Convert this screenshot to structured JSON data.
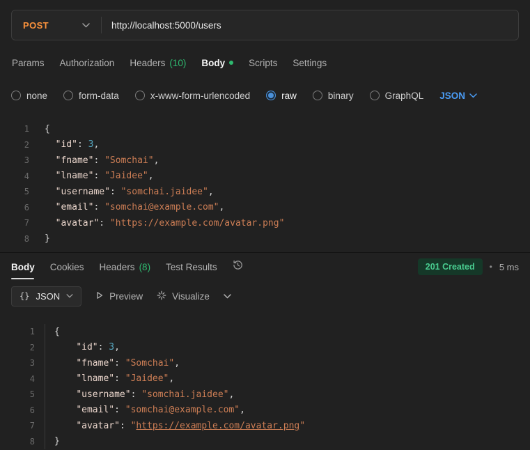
{
  "request": {
    "method": "POST",
    "url": "http://localhost:5000/users",
    "tabs": [
      {
        "label": "Params"
      },
      {
        "label": "Authorization"
      },
      {
        "label": "Headers",
        "count": "(10)"
      },
      {
        "label": "Body"
      },
      {
        "label": "Scripts"
      },
      {
        "label": "Settings"
      }
    ],
    "body_types": [
      "none",
      "form-data",
      "x-www-form-urlencoded",
      "raw",
      "binary",
      "GraphQL"
    ],
    "language": "JSON"
  },
  "request_code": [
    [
      {
        "t": "{",
        "c": "p"
      }
    ],
    [
      {
        "t": "  ",
        "c": "p"
      },
      {
        "t": "\"id\"",
        "c": "k"
      },
      {
        "t": ": ",
        "c": "p"
      },
      {
        "t": "3",
        "c": "n"
      },
      {
        "t": ",",
        "c": "p"
      }
    ],
    [
      {
        "t": "  ",
        "c": "p"
      },
      {
        "t": "\"fname\"",
        "c": "k"
      },
      {
        "t": ": ",
        "c": "p"
      },
      {
        "t": "\"Somchai\"",
        "c": "s"
      },
      {
        "t": ",",
        "c": "p"
      }
    ],
    [
      {
        "t": "  ",
        "c": "p"
      },
      {
        "t": "\"lname\"",
        "c": "k"
      },
      {
        "t": ": ",
        "c": "p"
      },
      {
        "t": "\"Jaidee\"",
        "c": "s"
      },
      {
        "t": ",",
        "c": "p"
      }
    ],
    [
      {
        "t": "  ",
        "c": "p"
      },
      {
        "t": "\"username\"",
        "c": "k"
      },
      {
        "t": ": ",
        "c": "p"
      },
      {
        "t": "\"somchai.jaidee\"",
        "c": "s"
      },
      {
        "t": ",",
        "c": "p"
      }
    ],
    [
      {
        "t": "  ",
        "c": "p"
      },
      {
        "t": "\"email\"",
        "c": "k"
      },
      {
        "t": ": ",
        "c": "p"
      },
      {
        "t": "\"somchai@example.com\"",
        "c": "s"
      },
      {
        "t": ",",
        "c": "p"
      }
    ],
    [
      {
        "t": "  ",
        "c": "p"
      },
      {
        "t": "\"avatar\"",
        "c": "k"
      },
      {
        "t": ": ",
        "c": "p"
      },
      {
        "t": "\"https://example.com/avatar.png\"",
        "c": "s"
      }
    ],
    [
      {
        "t": "}",
        "c": "p"
      }
    ]
  ],
  "response": {
    "tabs": [
      {
        "label": "Body"
      },
      {
        "label": "Cookies"
      },
      {
        "label": "Headers",
        "count": "(8)"
      },
      {
        "label": "Test Results"
      }
    ],
    "status": "201 Created",
    "separator": "•",
    "time": "5 ms",
    "braces_icon": "{}",
    "format_label": "JSON",
    "preview_label": "Preview",
    "visualize_label": "Visualize"
  },
  "response_code": [
    [
      {
        "t": "{",
        "c": "p"
      }
    ],
    [
      {
        "t": "    ",
        "c": "p"
      },
      {
        "t": "\"id\"",
        "c": "k"
      },
      {
        "t": ": ",
        "c": "p"
      },
      {
        "t": "3",
        "c": "n"
      },
      {
        "t": ",",
        "c": "p"
      }
    ],
    [
      {
        "t": "    ",
        "c": "p"
      },
      {
        "t": "\"fname\"",
        "c": "k"
      },
      {
        "t": ": ",
        "c": "p"
      },
      {
        "t": "\"Somchai\"",
        "c": "s"
      },
      {
        "t": ",",
        "c": "p"
      }
    ],
    [
      {
        "t": "    ",
        "c": "p"
      },
      {
        "t": "\"lname\"",
        "c": "k"
      },
      {
        "t": ": ",
        "c": "p"
      },
      {
        "t": "\"Jaidee\"",
        "c": "s"
      },
      {
        "t": ",",
        "c": "p"
      }
    ],
    [
      {
        "t": "    ",
        "c": "p"
      },
      {
        "t": "\"username\"",
        "c": "k"
      },
      {
        "t": ": ",
        "c": "p"
      },
      {
        "t": "\"somchai.jaidee\"",
        "c": "s"
      },
      {
        "t": ",",
        "c": "p"
      }
    ],
    [
      {
        "t": "    ",
        "c": "p"
      },
      {
        "t": "\"email\"",
        "c": "k"
      },
      {
        "t": ": ",
        "c": "p"
      },
      {
        "t": "\"somchai@example.com\"",
        "c": "s"
      },
      {
        "t": ",",
        "c": "p"
      }
    ],
    [
      {
        "t": "    ",
        "c": "p"
      },
      {
        "t": "\"avatar\"",
        "c": "k"
      },
      {
        "t": ": ",
        "c": "p"
      },
      {
        "t": "\"",
        "c": "s"
      },
      {
        "t": "https://example.com/avatar.png",
        "c": "l"
      },
      {
        "t": "\"",
        "c": "s"
      }
    ],
    [
      {
        "t": "}",
        "c": "p"
      }
    ]
  ],
  "colors": {
    "method": "#fb923c",
    "accent-green": "#2fba70",
    "link-blue": "#4a9cf5",
    "radio-blue": "#4a90d9",
    "status-text": "#49cc90",
    "status-bg": "#153828",
    "code-key": "#ecd7cd",
    "code-string": "#cd7e55",
    "code-number": "#56a8c2",
    "code-punct": "#d6d6d6"
  }
}
